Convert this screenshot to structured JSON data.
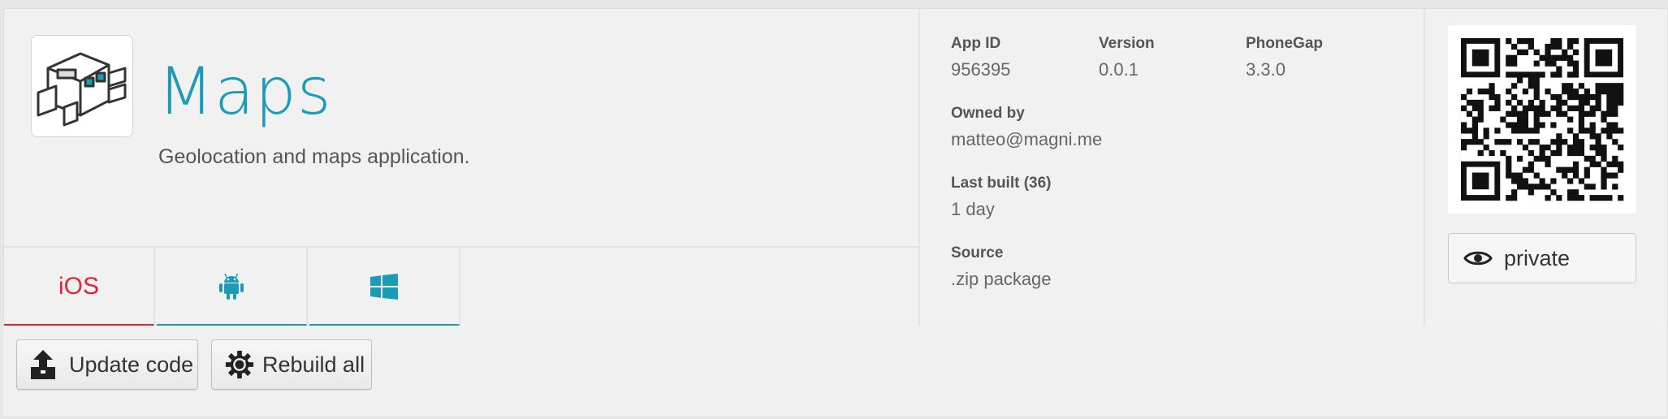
{
  "app": {
    "title": "Maps",
    "description": "Geolocation and maps application.",
    "icon": "phonegap-robot-icon"
  },
  "tabs": [
    {
      "label": "iOS",
      "icon": "ios-text",
      "active": true,
      "color": "#e0243a"
    },
    {
      "label": "",
      "icon": "android-icon",
      "active": false,
      "color": "#1a9bb8"
    },
    {
      "label": "",
      "icon": "windows-icon",
      "active": false,
      "color": "#1a9bb8"
    }
  ],
  "meta": {
    "app_id_label": "App ID",
    "app_id_value": "956395",
    "version_label": "Version",
    "version_value": "0.0.1",
    "phonegap_label": "PhoneGap",
    "phonegap_value": "3.3.0",
    "owner_label": "Owned by",
    "owner_value": "matteo@magni.me",
    "last_built_label": "Last built (36)",
    "last_built_value": "1 day",
    "source_label": "Source",
    "source_value": ".zip package"
  },
  "qr": {
    "icon": "qr-code"
  },
  "privacy": {
    "label": "private",
    "icon": "eye-icon"
  },
  "actions": {
    "update_label": "Update code",
    "update_icon": "upload-icon",
    "rebuild_label": "Rebuild all",
    "rebuild_icon": "gear-refresh-icon"
  },
  "colors": {
    "accent": "#1a9bb8",
    "ios": "#e0243a"
  }
}
